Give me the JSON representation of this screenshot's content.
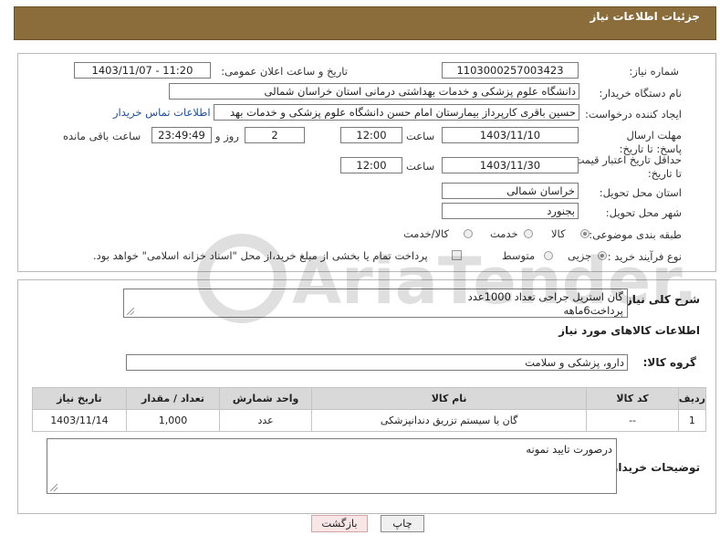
{
  "header": {
    "title": "جزئیات اطلاعات نیاز"
  },
  "form": {
    "need_number_label": "شماره نیاز:",
    "need_number_value": "1103000257003423",
    "announce_label": "تاریخ و ساعت اعلان عمومی:",
    "announce_value": "1403/11/07 - 11:20",
    "buyer_org_label": "نام دستگاه خریدار:",
    "buyer_org_value": "دانشگاه علوم پزشکی و خدمات بهداشتی درمانی استان خراسان شمالی",
    "requester_label": "ایجاد کننده درخواست:",
    "requester_value": "حسین باقری کارپرداز بیمارستان امام حسن دانشگاه علوم پزشکی و خدمات بهد",
    "contact_link": "اطلاعات تماس خریدار",
    "deadline_label": "مهلت ارسال پاسخ: تا تاریخ:",
    "deadline_date": "1403/11/10",
    "time_label": "ساعت",
    "deadline_time": "12:00",
    "days_value": "2",
    "days_label": "روز و",
    "remaining_time": "23:49:49",
    "remaining_label": "ساعت باقی مانده",
    "validity_label": "حداقل تاریخ اعتبار قیمت: تا تاریخ:",
    "validity_date": "1403/11/30",
    "validity_time": "12:00",
    "province_label": "استان محل تحویل:",
    "province_value": "خراسان شمالی",
    "city_label": "شهر محل تحویل:",
    "city_value": "بجنورد",
    "category_label": "طبقه بندی موضوعی:",
    "category_options": [
      "کالا",
      "خدمت",
      "کالا/خدمت"
    ],
    "process_label": "نوع فرآیند خرید :",
    "process_options": [
      "جزیی",
      "متوسط"
    ],
    "payment_note": "پرداخت تمام یا بخشی از مبلغ خرید،از محل \"اسناد خزانه اسلامی\" خواهد بود."
  },
  "description": {
    "label": "شرح کلی نیاز:",
    "line1": "گان استریل جراحی تعداد 1000عدد",
    "line2": "پرداخت6ماهه"
  },
  "goods": {
    "section_title": "اطلاعات کالاهای مورد نیاز",
    "group_label": "گروه کالا:",
    "group_value": "دارو، پزشکی و سلامت",
    "columns": [
      "ردیف",
      "کد کالا",
      "نام کالا",
      "واحد شمارش",
      "تعداد / مقدار",
      "تاریخ نیاز"
    ],
    "rows": [
      [
        "1",
        "--",
        "گان یا سیستم تزریق دندانپزشکی",
        "عدد",
        "1,000",
        "1403/11/14"
      ]
    ]
  },
  "buyer_notes": {
    "label": "توضیحات خریدار:",
    "value": "درصورت تایید نمونه"
  },
  "buttons": {
    "print": "چاپ",
    "back": "بازگشت"
  },
  "watermark": {
    "text": "AriaTender.neT"
  }
}
